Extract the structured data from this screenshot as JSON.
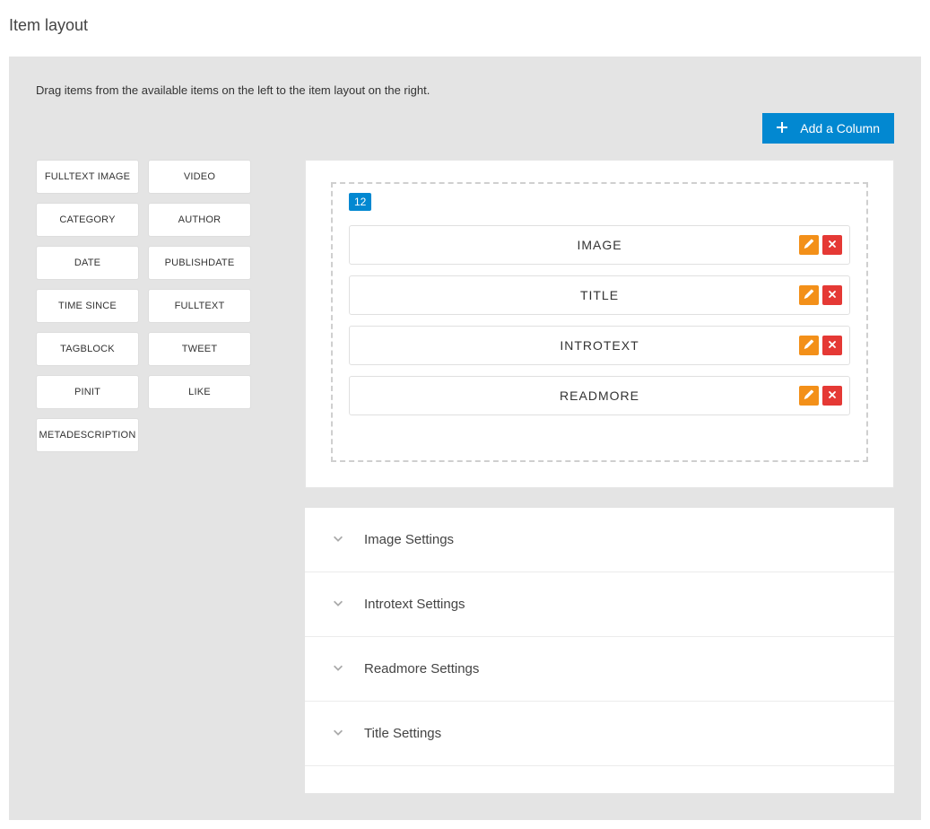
{
  "header": {
    "title": "Item layout"
  },
  "panel": {
    "instruction": "Drag items from the available items on the left to the item layout on the right.",
    "add_column_label": "Add a Column"
  },
  "available_items": [
    "FULLTEXT IMAGE",
    "VIDEO",
    "CATEGORY",
    "AUTHOR",
    "DATE",
    "PUBLISHDATE",
    "TIME SINCE",
    "FULLTEXT",
    "TAGBLOCK",
    "TWEET",
    "PINIT",
    "LIKE",
    "METADESCRIPTION"
  ],
  "layout": {
    "column_width": "12",
    "placed": [
      "IMAGE",
      "TITLE",
      "INTROTEXT",
      "READMORE"
    ]
  },
  "settings_panels": [
    "Image Settings",
    "Introtext Settings",
    "Readmore Settings",
    "Title Settings"
  ]
}
